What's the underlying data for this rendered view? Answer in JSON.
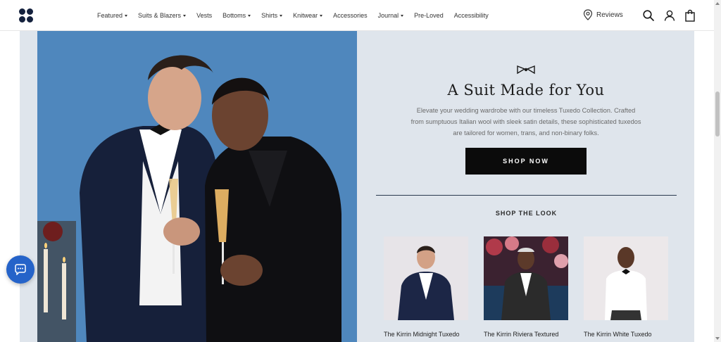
{
  "header": {
    "logo_icon": "four-dots-logo",
    "nav": [
      {
        "label": "Featured",
        "dropdown": true
      },
      {
        "label": "Suits & Blazers",
        "dropdown": true
      },
      {
        "label": "Vests",
        "dropdown": false
      },
      {
        "label": "Bottoms",
        "dropdown": true
      },
      {
        "label": "Shirts",
        "dropdown": true
      },
      {
        "label": "Knitwear",
        "dropdown": true
      },
      {
        "label": "Accessories",
        "dropdown": false
      },
      {
        "label": "Journal",
        "dropdown": true
      },
      {
        "label": "Pre-Loved",
        "dropdown": false
      },
      {
        "label": "Accessibility",
        "dropdown": false
      }
    ],
    "reviews_label": "Reviews",
    "icons": [
      "location-pin-icon",
      "search-icon",
      "account-icon",
      "bag-icon"
    ]
  },
  "hero": {
    "headline": "A Suit Made for You",
    "description": "Elevate your wedding wardrobe with our timeless Tuxedo Collection. Crafted from sumptuous Italian wool with sleek satin details, these sophisticated tuxedos are tailored for women, trans, and non-binary folks.",
    "cta": "SHOP NOW",
    "ornament_icon": "bowtie-icon"
  },
  "shop_the_look": {
    "title": "SHOP THE LOOK",
    "products": [
      {
        "name": "The Kirrin Midnight Tuxedo"
      },
      {
        "name": "The Kirrin Riviera Textured"
      },
      {
        "name": "The Kirrin White Tuxedo"
      }
    ]
  },
  "colors": {
    "brand_navy": "#14213d",
    "panel_bg": "#dfe5ec",
    "photo_bg": "#4f87bd",
    "cta_bg": "#0b0b0b",
    "chat_blue": "#2563c9"
  }
}
